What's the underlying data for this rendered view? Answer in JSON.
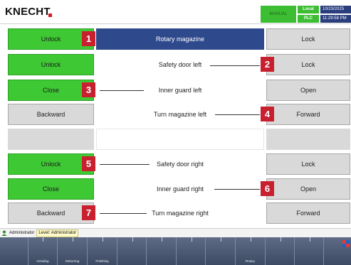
{
  "header": {
    "logo": "KNECHT",
    "mode": "MANUAL",
    "location_local": "Local",
    "location_plc": "PLC",
    "date": "10/23/2025",
    "time": "11:29:58 PM"
  },
  "rows": [
    {
      "left": "Unlock",
      "label": "Rotary magazine",
      "right": "Lock"
    },
    {
      "left": "Unlock",
      "label": "Safety door left",
      "right": "Lock"
    },
    {
      "left": "Close",
      "label": "Inner guard left",
      "right": "Open"
    },
    {
      "left": "Backward",
      "label": "Turn magazine left",
      "right": "Forward"
    },
    {
      "left": "",
      "label": "",
      "right": ""
    },
    {
      "left": "Unlock",
      "label": "Safety door right",
      "right": "Lock"
    },
    {
      "left": "Close",
      "label": "Inner guard right",
      "right": "Open"
    },
    {
      "left": "Backward",
      "label": "Turn magazine right",
      "right": "Forward"
    }
  ],
  "callouts": [
    "1",
    "2",
    "3",
    "4",
    "5",
    "6",
    "7"
  ],
  "status": {
    "user": "Administrator",
    "level": "Level: Administrator"
  },
  "toolbar": {
    "items": [
      "",
      "Grinding",
      "Deburring",
      "Polishing",
      "",
      "",
      "",
      "",
      "Rotary",
      "",
      "",
      ""
    ]
  },
  "colors": {
    "green": "#3ec934",
    "gray": "#d9d9d9",
    "selected": "#2e4a8c",
    "callout": "#c8202f",
    "toolbar": "#4d5a73"
  }
}
